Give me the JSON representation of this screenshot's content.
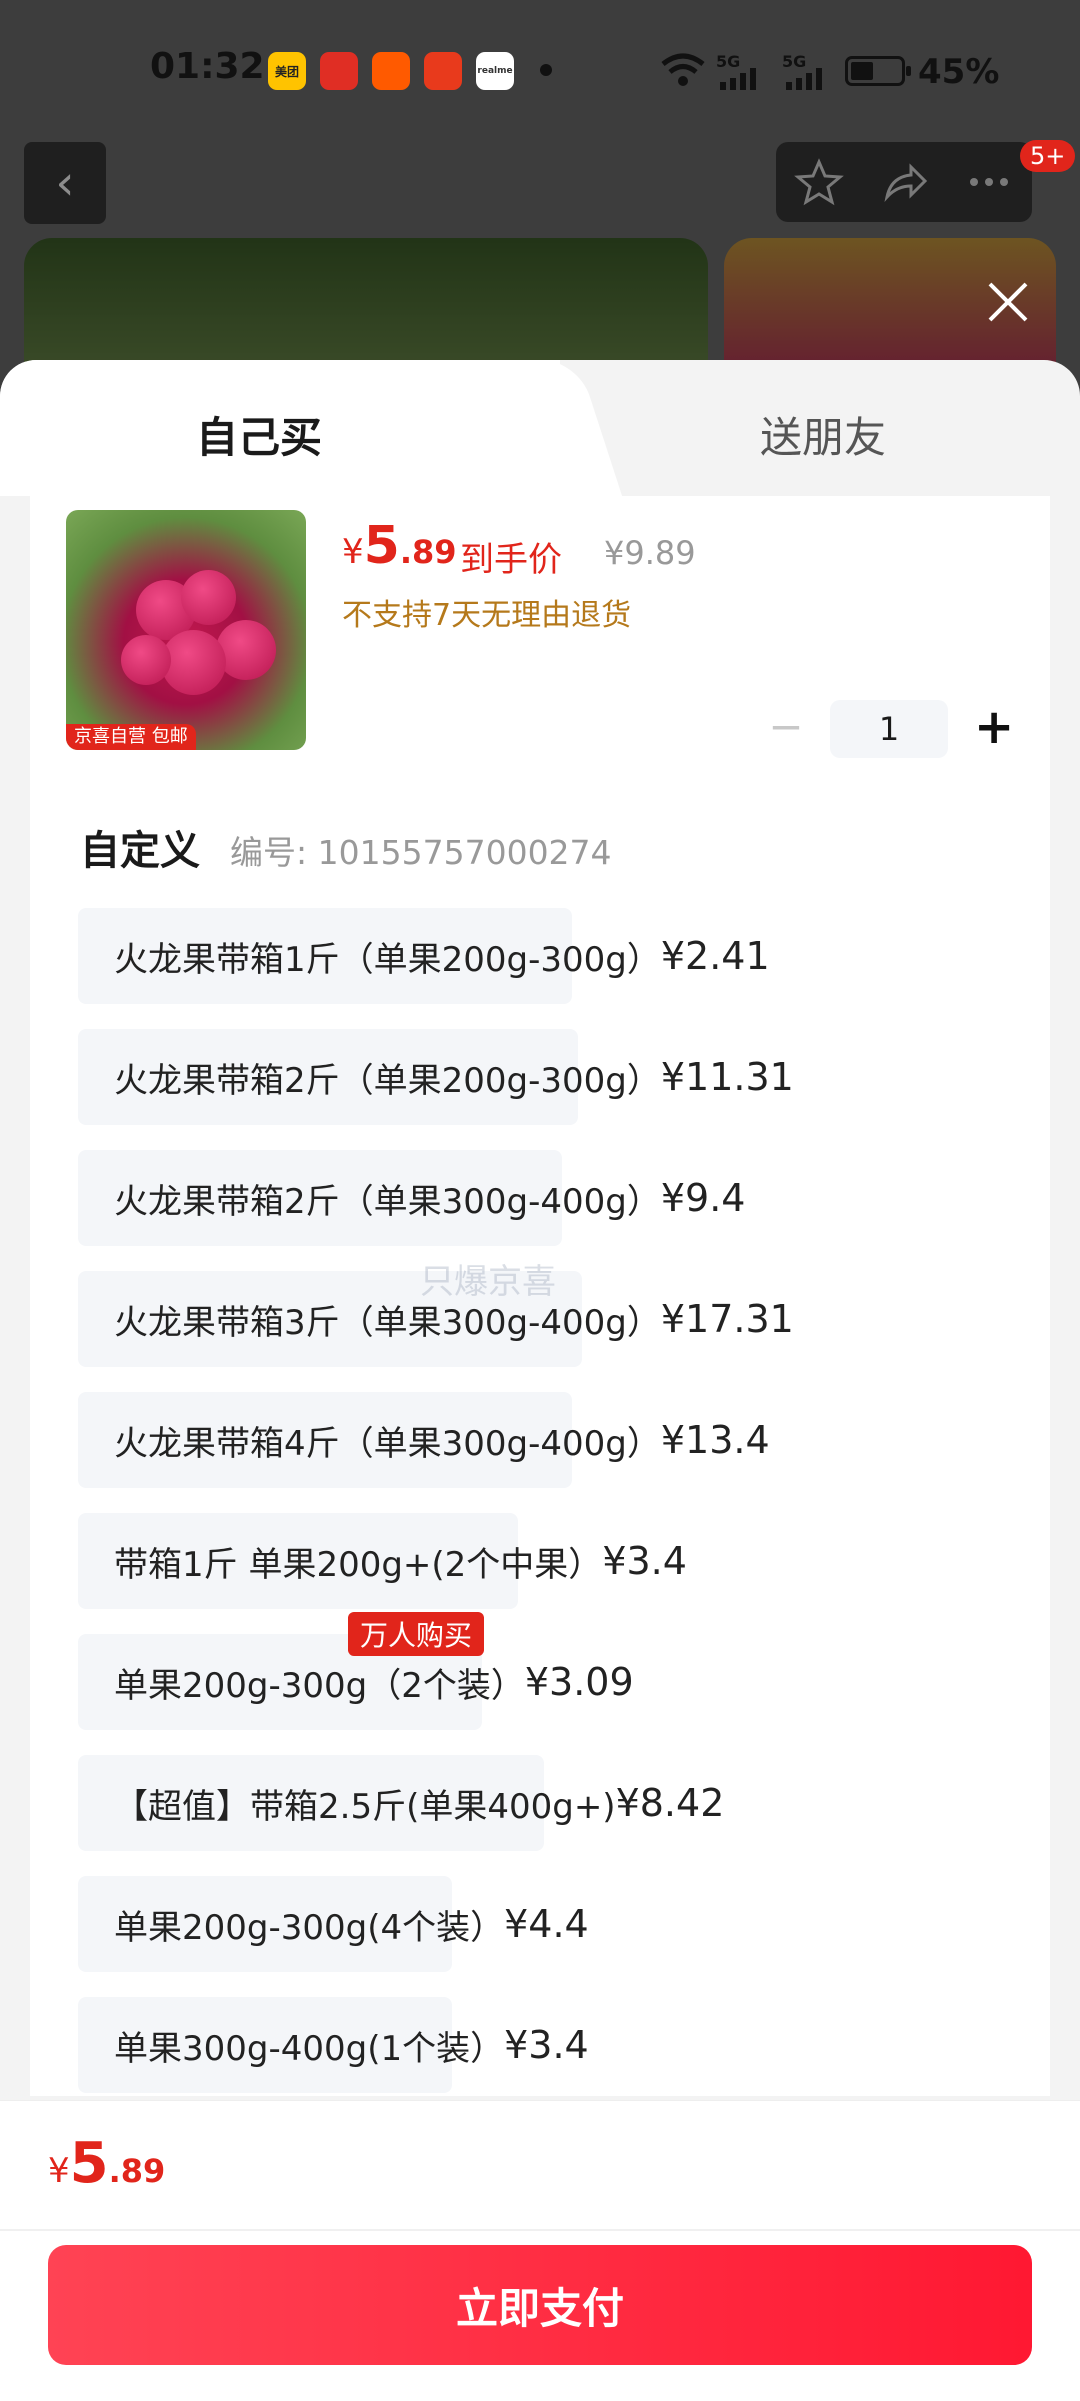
{
  "status_bar": {
    "time": "01:32",
    "apps": [
      {
        "name": "meituan-icon",
        "label": "美团",
        "color": "#ffc300"
      },
      {
        "name": "pinduoduo-icon",
        "label": "",
        "color": "#e02e24"
      },
      {
        "name": "app3-icon",
        "label": "",
        "color": "#ff5a00"
      },
      {
        "name": "app4-icon",
        "label": "",
        "color": "#e83a1c"
      },
      {
        "name": "realme-icon",
        "label": "realme",
        "color": "#ffffff"
      }
    ],
    "network1": "5G",
    "network2": "5G",
    "battery_percent": "45%",
    "battery_level": 0.45
  },
  "background": {
    "badge": "5+"
  },
  "tabs": {
    "self": "自己买",
    "friend": "送朋友"
  },
  "product": {
    "image_tag": "京喜自营 包邮",
    "price_symbol": "¥",
    "price_int": "5",
    "price_dec": ".89",
    "price_label": "到手价",
    "original_price": "¥9.89",
    "return_policy": "不支持7天无理由退货",
    "quantity": "1"
  },
  "spec": {
    "title": "自定义",
    "code": "编号: 10155757000274"
  },
  "watermark": "只爆京喜",
  "options": [
    {
      "label": "火龙果带箱1斤（单果200g-300g）",
      "price": "¥2.41"
    },
    {
      "label": "火龙果带箱2斤（单果200g-300g）",
      "price": "¥11.31"
    },
    {
      "label": "火龙果带箱2斤（单果300g-400g）",
      "price": "¥9.4"
    },
    {
      "label": "火龙果带箱3斤（单果300g-400g）",
      "price": "¥17.31"
    },
    {
      "label": "火龙果带箱4斤（单果300g-400g）",
      "price": "¥13.4"
    },
    {
      "label": "带箱1斤 单果200g+(2个中果）",
      "price": "¥3.4"
    },
    {
      "label": "单果200g-300g（2个装）",
      "price": "¥3.09",
      "badge": "万人购买"
    },
    {
      "label": "【超值】带箱2.5斤(单果400g+)",
      "price": "¥8.42"
    },
    {
      "label": "单果200g-300g(4个装）",
      "price": "¥4.4"
    },
    {
      "label": "单果300g-400g(1个装）",
      "price": "¥3.4"
    }
  ],
  "footer": {
    "price_symbol": "¥",
    "price_int": "5",
    "price_dec": ".89",
    "pay_label": "立即支付"
  }
}
